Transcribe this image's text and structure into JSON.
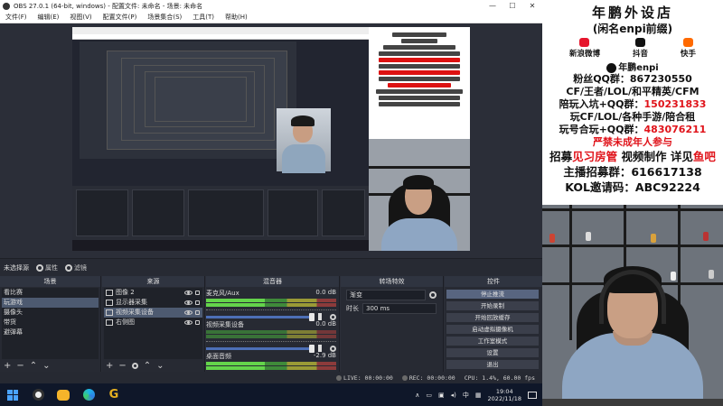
{
  "window": {
    "title": "OBS 27.0.1 (64-bit, windows) - 配置文件: 未命名 - 场景: 未命名",
    "controls": [
      "—",
      "☐",
      "✕"
    ]
  },
  "menu": [
    "文件(F)",
    "编辑(E)",
    "视图(V)",
    "配置文件(P)",
    "场景集合(S)",
    "工具(T)",
    "帮助(H)"
  ],
  "source_bar": {
    "no_source": "未选择源",
    "properties": "属性",
    "filters": "滤镜"
  },
  "scenes": {
    "header": "场景",
    "items": [
      "看比赛",
      "玩游戏",
      "摄像头",
      "带货",
      "避弹幕"
    ],
    "selected": 1
  },
  "sources": {
    "header": "来源",
    "items": [
      "图像 2",
      "显示器采集",
      "视频采集设备",
      "右侧图"
    ],
    "selected": 2
  },
  "mixer": {
    "header": "混音器",
    "channels": [
      {
        "name": "麦克风/Aux",
        "db": "0.0 dB"
      },
      {
        "name": "视频采集设备",
        "db": "0.0 dB"
      },
      {
        "name": "桌面音频",
        "db": "-2.9 dB"
      }
    ],
    "tick_labels": [
      "-60",
      "-45",
      "-30",
      "-20",
      "-10",
      "-5",
      "0"
    ]
  },
  "transitions": {
    "header": "转场特效",
    "type": "渐变",
    "duration_label": "时长",
    "duration": "300 ms"
  },
  "controls": {
    "header": "控件",
    "buttons": [
      "停止推流",
      "开始录制",
      "开始回放缓存",
      "启动虚拟摄像机",
      "工作室模式",
      "设置",
      "退出"
    ]
  },
  "status": {
    "live": "LIVE: 00:00:00",
    "rec": "REC: 00:00:00",
    "cpu": "CPU: 1.4%, 60.00 fps"
  },
  "taskbar": {
    "ime": "中",
    "time": "19:04",
    "date": "2022/11/18"
  },
  "poster": {
    "title": "年鹏外设店",
    "subtitle": "(闲名enpi前缀)",
    "socials": [
      "新浪微博",
      "抖音",
      "快手"
    ],
    "brand": "年鹏enpi",
    "fans_label": "粉丝QQ群：",
    "fans_num": "867230550",
    "line_games": "CF/王者/LOL/和平精英/CFM",
    "line_escort_label": "陪玩入坑+QQ群：",
    "line_escort_num": "150231833",
    "line_play": "玩CF/LOL/各种手游/陪合租",
    "line_play2_label": "玩号合玩+QQ群：",
    "line_play2_num": "483076211",
    "warning": "严禁未成年人参与",
    "recruit_a": "招募",
    "recruit_b": "见习房管",
    "recruit_c": " 视频制作 ",
    "recruit_d": "详见",
    "recruit_e": "鱼吧",
    "anchor": "主播招募群：616617138",
    "kol": "KOL邀请码：ABC92224"
  }
}
